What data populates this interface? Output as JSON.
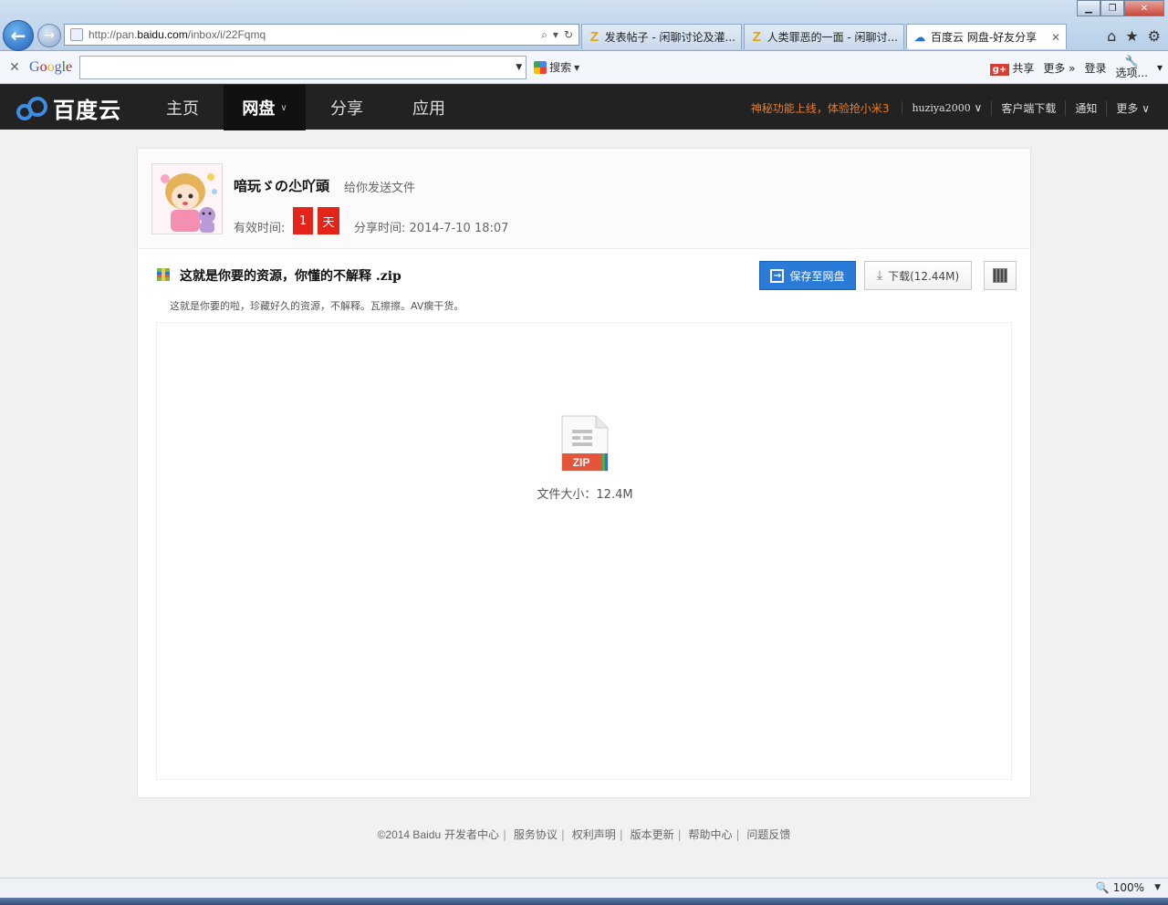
{
  "browser": {
    "url_prefix": "http://pan.",
    "url_domain": "baidu.com",
    "url_path": "/inbox/i/22Fqmq",
    "tabs": [
      {
        "label": "发表帖子 - 闲聊讨论及灌...",
        "icon": "Z"
      },
      {
        "label": "人类罪恶的一面 - 闲聊讨...",
        "icon": "Z"
      },
      {
        "label": "百度云 网盘-好友分享",
        "icon": "baidu-cloud-icon",
        "active": true
      }
    ],
    "google_toolbar": {
      "search_label": "搜索",
      "share_label": "共享",
      "more_label": "更多 »",
      "login_label": "登录",
      "options_label": "选项..."
    },
    "zoom": "100%"
  },
  "header": {
    "logo_text": "百度云",
    "nav": [
      {
        "label": "主页"
      },
      {
        "label": "网盘",
        "active": true
      },
      {
        "label": "分享"
      },
      {
        "label": "应用"
      }
    ],
    "promo": "神秘功能上线，体验抢小米3",
    "username": "huziya2000",
    "client_download": "客户端下载",
    "notify": "通知",
    "more": "更多"
  },
  "share": {
    "sender_name": "喑玩ゞの尐吖頭",
    "action": "给你发送文件",
    "expiry_label": "有效时间:",
    "expiry_value": "1",
    "expiry_unit": "天",
    "share_time_label": "分享时间:",
    "share_time": "2014-7-10 18:07"
  },
  "file": {
    "title": "这就是你要的资源，你懂的不解释 .zip",
    "description": "这就是你要的啦，珍藏好久的资源，不解释。瓦擦擦。AV瘸干货。",
    "save_label": "保存至网盘",
    "download_label": "下载(12.44M)",
    "icon_badge": "ZIP",
    "size_label": "文件大小：12.4M"
  },
  "footer": {
    "copyright": "©2014 Baidu",
    "links": [
      "开发者中心",
      "服务协议",
      "权利声明",
      "版本更新",
      "帮助中心",
      "问题反馈"
    ]
  }
}
